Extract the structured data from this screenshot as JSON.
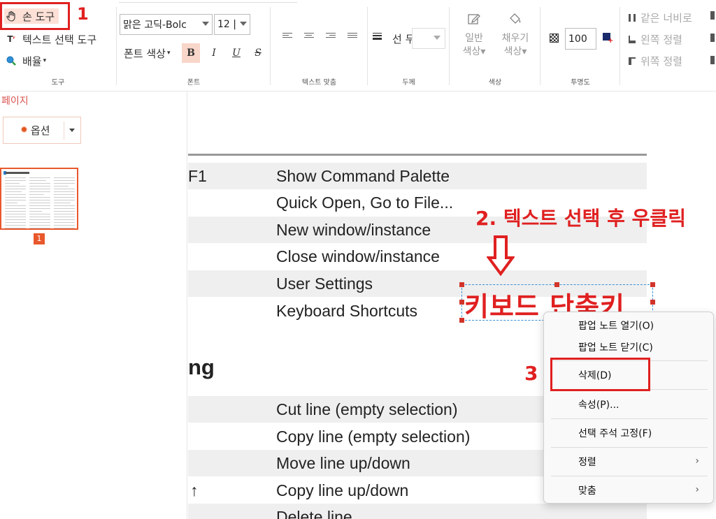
{
  "toolbar": {
    "tools": {
      "hand": "손 도구",
      "text_select": "텍스트 선택 도구",
      "zoom": "배율"
    },
    "font": {
      "family": "맑은 고딕-Bolc",
      "size": "12 |",
      "color_label": "폰트 색상",
      "bold": "B",
      "italic": "I",
      "underline": "U",
      "strike": "S"
    },
    "line": {
      "line_label": "선 두"
    },
    "color": {
      "normal": "일반\n색상",
      "normal_1": "일반",
      "normal_2": "색상",
      "fill_1": "채우기",
      "fill_2": "색상"
    },
    "opacity": {
      "value": "100"
    },
    "arrange": {
      "same_width": "같은 너비로",
      "align_left": "왼쪽 정렬",
      "align_top": "위쪽 정렬"
    },
    "group_labels": {
      "tools": "도구",
      "font": "폰트",
      "text_align": "텍스트 맞춤",
      "thickness": "두께",
      "color": "색상",
      "opacity": "투명도"
    }
  },
  "left_panel": {
    "title": "페이지",
    "options_button": "옵션",
    "page_number": "1"
  },
  "document": {
    "rows": [
      {
        "key": "F1",
        "desc": "Show Command Palette"
      },
      {
        "key": "",
        "desc": "Quick Open, Go to File..."
      },
      {
        "key": "",
        "desc": "New window/instance"
      },
      {
        "key": "",
        "desc": "Close window/instance"
      },
      {
        "key": "",
        "desc": "User Settings"
      },
      {
        "key": "",
        "desc": "Keyboard Shortcuts"
      }
    ],
    "section_heading": "ng",
    "rows2": [
      {
        "key": "",
        "desc": "Cut line (empty selection)"
      },
      {
        "key": "",
        "desc": "Copy line (empty selection)"
      },
      {
        "key": "",
        "desc": "Move line up/down"
      },
      {
        "key": "↑",
        "desc": "Copy line up/down"
      },
      {
        "key": "",
        "desc": "Delete line"
      }
    ],
    "selected_annotation_text": "키보드 단축키"
  },
  "annotations": {
    "step1": "1",
    "step2": "2. 텍스트 선택 후 우클릭",
    "step3": "3"
  },
  "context_menu": {
    "items": [
      "팝업 노트 열기(O)",
      "팝업 노트 닫기(C)",
      "삭제(D)",
      "속성(P)...",
      "선택 주석 고정(F)",
      "정렬",
      "맞춤"
    ]
  },
  "colors": {
    "accent": "#e8582c",
    "annotation_red": "#e02020",
    "selection_blue": "#3a8fd6"
  }
}
